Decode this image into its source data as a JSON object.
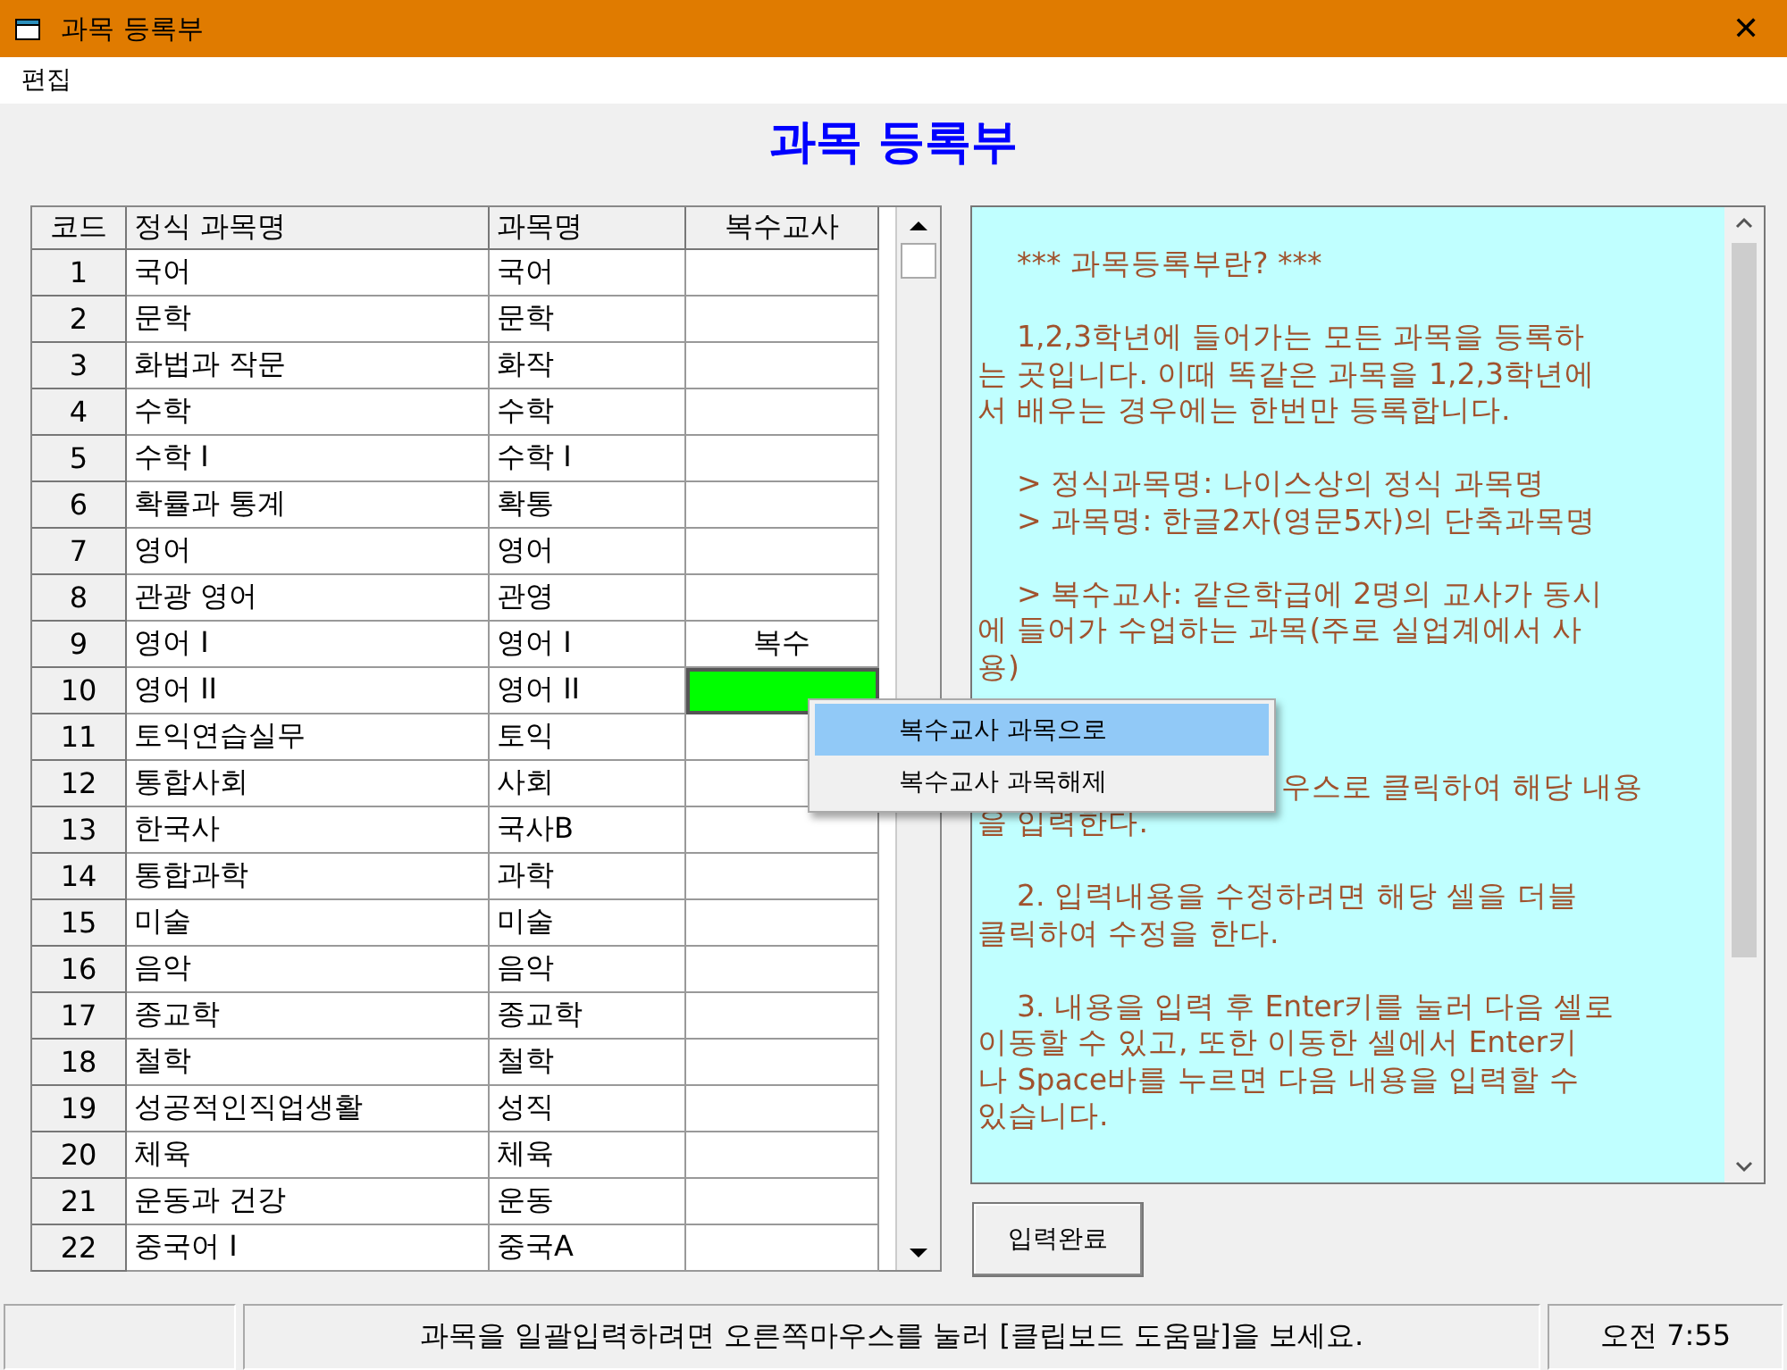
{
  "window": {
    "title": "과목 등록부",
    "close": "✕"
  },
  "menu": [
    "편집"
  ],
  "heading": "과목 등록부",
  "table": {
    "columns": [
      "코드",
      "정식 과목명",
      "과목명",
      "복수교사"
    ],
    "rows": [
      {
        "code": "1",
        "full_name": "국어",
        "name": "국어",
        "selected": false
      },
      {
        "code": "2",
        "full_name": "문학",
        "name": "문학",
        "selected": false
      },
      {
        "code": "3",
        "full_name": "화법과 작문",
        "name": "화작",
        "selected": false
      },
      {
        "code": "4",
        "full_name": "수학",
        "name": "수학",
        "selected": false
      },
      {
        "code": "5",
        "full_name": "수학 I",
        "name": "수학 I",
        "selected": false
      },
      {
        "code": "6",
        "full_name": "확률과 통계",
        "name": "확통",
        "selected": false
      },
      {
        "code": "7",
        "full_name": "영어",
        "name": "영어",
        "selected": false
      },
      {
        "code": "8",
        "full_name": "관광 영어",
        "name": "관영",
        "selected": false
      },
      {
        "code": "9",
        "full_name": "영어 I",
        "name": "영어 I",
        "multi": "복수",
        "selected": false
      },
      {
        "code": "10",
        "full_name": "영어 II",
        "name": "영어 II",
        "selected": true
      },
      {
        "code": "11",
        "full_name": "토익연습실무",
        "name": "토익",
        "selected": false
      },
      {
        "code": "12",
        "full_name": "통합사회",
        "name": "사회",
        "selected": false
      },
      {
        "code": "13",
        "full_name": "한국사",
        "name": "국사B",
        "selected": false
      },
      {
        "code": "14",
        "full_name": "통합과학",
        "name": "과학",
        "selected": false
      },
      {
        "code": "15",
        "full_name": "미술",
        "name": "미술",
        "selected": false
      },
      {
        "code": "16",
        "full_name": "음악",
        "name": "음악",
        "selected": false
      },
      {
        "code": "17",
        "full_name": "종교학",
        "name": "종교학",
        "selected": false
      },
      {
        "code": "18",
        "full_name": "철학",
        "name": "철학",
        "selected": false
      },
      {
        "code": "19",
        "full_name": "성공적인직업생활",
        "name": "성직",
        "selected": false
      },
      {
        "code": "20",
        "full_name": "체육",
        "name": "체육",
        "selected": false
      },
      {
        "code": "21",
        "full_name": "운동과 건강",
        "name": "운동",
        "selected": false
      },
      {
        "code": "22",
        "full_name": "중국어 I",
        "name": "중국A",
        "selected": false
      }
    ]
  },
  "help": {
    "paragraphs": [
      {
        "kind": "normal",
        "lines": [
          "*** 과목등록부란? ***"
        ]
      },
      {
        "kind": "normal",
        "lines": [
          "1,2,3학년에 들어가는 모든 과목을 등록하",
          "는 곳입니다. 이때 똑같은 과목을 1,2,3학년에",
          "서 배우는 경우에는 한번만 등록합니다."
        ]
      },
      {
        "kind": "list",
        "lines": [
          "> 정식과목명: 나이스상의 정식 과목명",
          "> 과목명: 한글2자(영문5자)의 단축과목명"
        ]
      },
      {
        "kind": "normal",
        "lines": [
          "> 복수교사: 같은학급에 2명의 교사가 동시",
          "에 들어가 수업하는 과목(주로 실업계에서 사",
          "용)"
        ]
      },
      {
        "kind": "partial",
        "lines": [
          "우스로 클릭하여 해당 내용",
          "을 입력한다."
        ]
      },
      {
        "kind": "normal",
        "lines": [
          "2. 입력내용을 수정하려면 해당 셀을 더블",
          "클릭하여 수정을 한다."
        ]
      },
      {
        "kind": "normal",
        "lines": [
          "3. 내용을 입력 후 Enter키를 눌러 다음 셀로",
          "이동할 수 있고, 또한 이동한 셀에서 Enter키",
          "나 Space바를 누르면 다음 내용을 입력할 수",
          "있습니다."
        ]
      }
    ]
  },
  "context_menu": [
    {
      "label": "복수교사 과목으로",
      "selected": true
    },
    {
      "label": "복수교사 과목해제",
      "selected": false
    }
  ],
  "button": "입력완료",
  "status_bar": {
    "message": "과목을 일괄입력하려면 오른쪽마우스를 눌러 [클립보드 도움말]을 보세요.",
    "time": "오전 7:55"
  }
}
